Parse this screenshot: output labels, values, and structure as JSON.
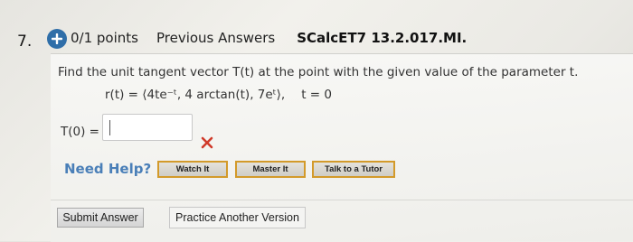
{
  "question": {
    "number": "7.",
    "points": "0/1 points",
    "previous_answers": "Previous Answers",
    "course_code": "SCalcET7 13.2.017.MI.",
    "prompt_text": "Find the unit tangent vector T(t) at the point with the given value of the parameter t.",
    "equation": "r(t) = ⟨4te⁻ᵗ, 4 arctan(t), 7eᵗ⟩,",
    "param": "t = 0"
  },
  "answer": {
    "label": "T(0) =",
    "value": "",
    "status": "incorrect"
  },
  "help": {
    "label": "Need Help?",
    "buttons": [
      "Watch It",
      "Master It",
      "Talk to a Tutor"
    ]
  },
  "actions": {
    "submit": "Submit Answer",
    "practice": "Practice Another Version"
  },
  "colors": {
    "plus_icon": "#2f6ea8",
    "need_help": "#4a7fb8",
    "incorrect": "#d03a2a",
    "help_border": "#d39a2a"
  }
}
